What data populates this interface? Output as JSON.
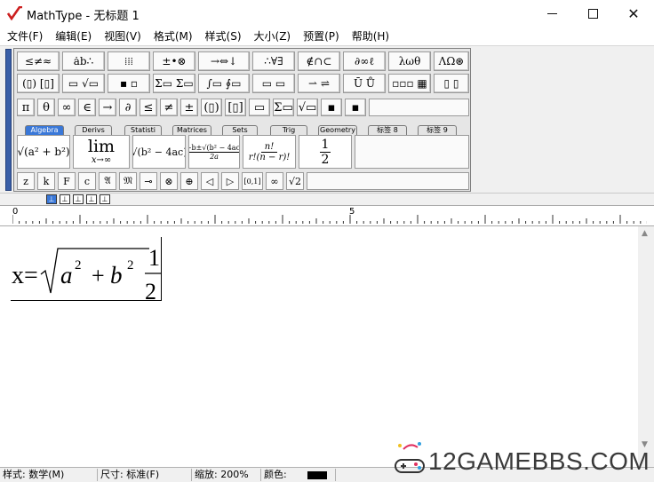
{
  "window": {
    "title": "MathType - 无标题 1",
    "brand_color": "#cc1f1f"
  },
  "menu": [
    "文件(F)",
    "编辑(E)",
    "视图(V)",
    "格式(M)",
    "样式(S)",
    "大小(Z)",
    "预置(P)",
    "帮助(H)"
  ],
  "palette_row1": [
    "≤≠≈",
    "ȧb∴",
    "⁞⁞⁞",
    "±•⊗",
    "→⇔↓",
    "∴∀∃",
    "∉∩⊂",
    "∂∞ℓ",
    "λωθ",
    "ΛΩ⊛"
  ],
  "palette_row2": [
    "(▯) [▯]",
    "▭ √▭",
    "▪ ▫",
    "Σ▭ Σ▭",
    "∫▭ ∮▭",
    "▭ ▭",
    "⇀ ⇌",
    "Ū Ů",
    "▫▫▫ ▦",
    "▯ ▯"
  ],
  "quick_symbols": [
    "π",
    "θ",
    "∞",
    "∈",
    "→",
    "∂",
    "≤",
    "≠",
    "±",
    "(▯)",
    "[▯]",
    "▭",
    "Σ▭",
    "√▭",
    "▪",
    "▪"
  ],
  "tabs": [
    "Algebra",
    "Derivs",
    "Statisti",
    "Matrices",
    "Sets",
    "Trig",
    "Geometry",
    "标签 8",
    "标签 9"
  ],
  "templates": [
    {
      "name": "sqrt-sum-template",
      "main": "√(a² + b²)"
    },
    {
      "name": "limit-template",
      "top": "lim",
      "bottom": "x→∞"
    },
    {
      "name": "sqrt-discriminant-template",
      "main": "√(b² − 4ac)"
    },
    {
      "name": "quadratic-formula-template",
      "top": "−b±√(b² − 4ac)",
      "bottom": "2a"
    },
    {
      "name": "binomial-coefficient-template",
      "top": "n!",
      "bottom": "r!(n − r)!"
    },
    {
      "name": "one-half-template",
      "top": "1",
      "bottom": "2"
    }
  ],
  "mini_templates": [
    "z",
    "k",
    "F",
    "c",
    "𝔄",
    "𝔐",
    "⊸",
    "⊗",
    "⊕",
    "◁",
    "▷",
    "[0,1]",
    "∞",
    "√2"
  ],
  "tab_stops": [
    "⊥",
    "⊥",
    "⊥",
    "⊥",
    "⊥"
  ],
  "ruler": {
    "start": "0",
    "mid": "5"
  },
  "equation": {
    "lhs": "x=",
    "radicand_a": "a",
    "exp_a": "2",
    "plus": "+",
    "radicand_b": "b",
    "exp_b": "2",
    "frac_num": "1",
    "frac_den": "2"
  },
  "status": {
    "style": "样式: 数学(M)",
    "size": "尺寸: 标准(F)",
    "zoom": "缩放: 200%",
    "color_label": "颜色:",
    "color": "#000000"
  },
  "watermark": {
    "text": "12GAMEBBS.COM"
  }
}
